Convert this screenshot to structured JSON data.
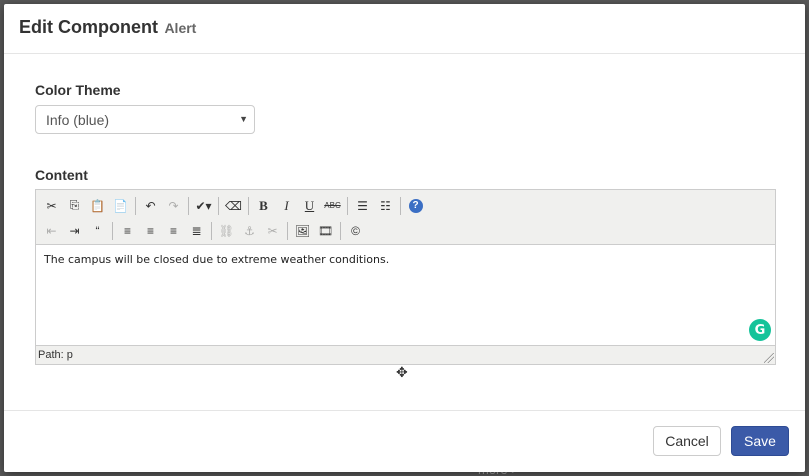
{
  "backdrop": {
    "peek_text": "more >"
  },
  "modal": {
    "title": "Edit Component",
    "subtitle": "Alert"
  },
  "form": {
    "color_theme_label": "Color Theme",
    "color_theme_value": "Info (blue)",
    "content_label": "Content"
  },
  "editor": {
    "toolbar_row1": [
      {
        "name": "cut-icon",
        "glyph": "✂"
      },
      {
        "name": "copy-icon",
        "glyph": "⎘"
      },
      {
        "name": "paste-icon",
        "glyph": "📋"
      },
      {
        "name": "paste-text-icon",
        "glyph": "📄"
      },
      {
        "sep": true
      },
      {
        "name": "undo-icon",
        "glyph": "↶"
      },
      {
        "name": "redo-icon",
        "glyph": "↷",
        "disabled": true
      },
      {
        "sep": true
      },
      {
        "name": "spellcheck-icon",
        "glyph": "✔▾"
      },
      {
        "sep": true
      },
      {
        "name": "eraser-icon",
        "glyph": "⌫"
      },
      {
        "sep": true
      },
      {
        "name": "bold-icon",
        "glyph": "B",
        "style": "b"
      },
      {
        "name": "italic-icon",
        "glyph": "I",
        "style": "i"
      },
      {
        "name": "underline-icon",
        "glyph": "U",
        "style": "u"
      },
      {
        "name": "strikethrough-icon",
        "glyph": "ABC"
      },
      {
        "sep": true
      },
      {
        "name": "bullet-list-icon",
        "glyph": "☰"
      },
      {
        "name": "numbered-list-icon",
        "glyph": "☷"
      },
      {
        "sep": true
      },
      {
        "name": "help-icon",
        "glyph": "?"
      }
    ],
    "toolbar_row2": [
      {
        "name": "outdent-icon",
        "glyph": "⇤",
        "disabled": true
      },
      {
        "name": "indent-icon",
        "glyph": "⇥"
      },
      {
        "name": "blockquote-icon",
        "glyph": "“"
      },
      {
        "sep": true
      },
      {
        "name": "align-left-icon",
        "glyph": "≡"
      },
      {
        "name": "align-center-icon",
        "glyph": "≡"
      },
      {
        "name": "align-right-icon",
        "glyph": "≡"
      },
      {
        "name": "align-justify-icon",
        "glyph": "≣"
      },
      {
        "sep": true
      },
      {
        "name": "link-icon",
        "glyph": "⛓",
        "disabled": true
      },
      {
        "name": "anchor-icon",
        "glyph": "⚓",
        "disabled": true
      },
      {
        "name": "unlink-icon",
        "glyph": "✂",
        "disabled": true
      },
      {
        "sep": true
      },
      {
        "name": "image-icon",
        "glyph": "🖼"
      },
      {
        "name": "media-icon",
        "glyph": "🎞"
      },
      {
        "sep": true
      },
      {
        "name": "copyright-icon",
        "glyph": "©"
      }
    ],
    "content_text": "The campus will be closed due to extreme weather conditions.",
    "status_path": "Path: p",
    "grammarly_glyph": "G"
  },
  "footer": {
    "cancel_label": "Cancel",
    "save_label": "Save"
  },
  "colors": {
    "primary": "#3b5aa8",
    "grammarly": "#15c39a"
  }
}
